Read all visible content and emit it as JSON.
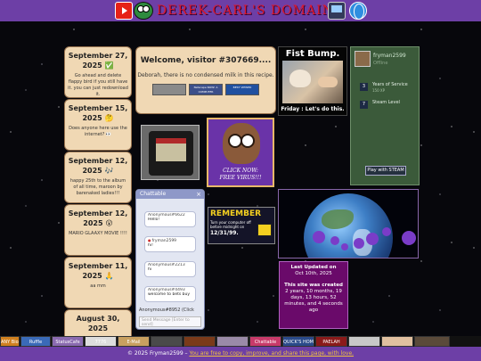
{
  "header": {
    "title": "DEREK-CARL'S DOMAIN",
    "icons": [
      "youtube-icon",
      "frog-icon",
      "computer-icon",
      "globe-icon"
    ]
  },
  "posts": [
    {
      "date": "September 27, 2025 ✅",
      "text": "Go ahead and delete flappy bird if you still have it. you can just redownload it."
    },
    {
      "date": "September 15, 2025 🤔",
      "text": "Does anyone here use the internet? 👀"
    },
    {
      "date": "September 12, 2025 🎶",
      "text": "happy 25th to the album of all time, maroon by barenaked ladies!!!"
    },
    {
      "date": "September 12, 2025 😮",
      "text": "MARIO GLAAXY MOVIE !!!!"
    },
    {
      "date": "September 11, 2025 🙏",
      "text": "aa mm"
    },
    {
      "date": "August 30, 2025",
      "text": ""
    }
  ],
  "welcome": {
    "title": "Welcome, visitor #307669....",
    "subtitle": "Deborah, there is no condensed milk in this recipe.",
    "badges": [
      "",
      "Netscape NOW! A COMPUTER",
      "BEST VIEWED"
    ]
  },
  "fist_bump": {
    "title": "Fist Bump.",
    "caption": "Friday : Let's do this."
  },
  "steam": {
    "username": "fryman2599",
    "status": "Offline",
    "badges": [
      {
        "num": "3",
        "label": "Years of Service",
        "xp": "150 XP"
      },
      {
        "num": "7",
        "label": "Steam Level",
        "xp": ""
      }
    ],
    "logo": "Play with STEAM"
  },
  "virus": {
    "line1": "CLICK NOW:",
    "line2": "FREE VIRUS!!!"
  },
  "chat": {
    "title": "Chattable",
    "close": "×",
    "messages": [
      {
        "user": "Anonymous#6622",
        "text": "Hello!",
        "dot": false
      },
      {
        "user": "fryman2599",
        "text": "hi!",
        "dot": true
      },
      {
        "user": "Anonymous#2213",
        "text": "hi",
        "dot": false
      },
      {
        "user": "Anonymous#4493",
        "text": "welcome to bets buy",
        "dot": false
      }
    ],
    "status": "Anonymous#8952 (Click",
    "placeholder": "Send Message [Enter to send]"
  },
  "remember": {
    "title": "REMEMBER",
    "text": "Turn your computer off before midnight on",
    "date": "12/31/99.",
    "logo": "BEST BUY"
  },
  "updated": {
    "label": "Last Updated on",
    "date": "Oct 10th, 2025",
    "created_label": "This site was created",
    "age": "2 years, 10 months, 19 days, 13 hours, 52 minutes, and 4 seconds ago"
  },
  "buttons": [
    {
      "label": "ANY Bios",
      "bg": "#d08020",
      "w": 22
    },
    {
      "label": "Ruffle",
      "bg": "#3a6ab8",
      "w": 34
    },
    {
      "label": "StatusCafe",
      "bg": "#8a6ab0",
      "w": 36
    },
    {
      "label": "7776",
      "bg": "#dddddd",
      "w": 36
    },
    {
      "label": "E-Mail",
      "bg": "#c8a060",
      "w": 36
    },
    {
      "label": "",
      "bg": "#4a4a4a",
      "w": 36
    },
    {
      "label": "",
      "bg": "#7a3a1a",
      "w": 36
    },
    {
      "label": "",
      "bg": "#9a8aa8",
      "w": 36
    },
    {
      "label": "Chattable",
      "bg": "#c83a6a",
      "w": 36
    },
    {
      "label": "QUICK'S HOME",
      "bg": "#2a4a8a",
      "w": 36
    },
    {
      "label": "PAELAH",
      "bg": "#8a1a1a",
      "w": 36
    },
    {
      "label": "",
      "bg": "#c8c8c8",
      "w": 36
    },
    {
      "label": "",
      "bg": "#e0c0a0",
      "w": 36
    },
    {
      "label": "",
      "bg": "#5a4a3a",
      "w": 40
    }
  ],
  "footer": {
    "copyright": "© 2025 Fryman2599 – ",
    "link": "You are free to copy, improve, and share this page, with love."
  },
  "colors": {
    "nav": "#6d3fa6",
    "card": "#f0d8b4",
    "title_red": "#e0172c"
  }
}
